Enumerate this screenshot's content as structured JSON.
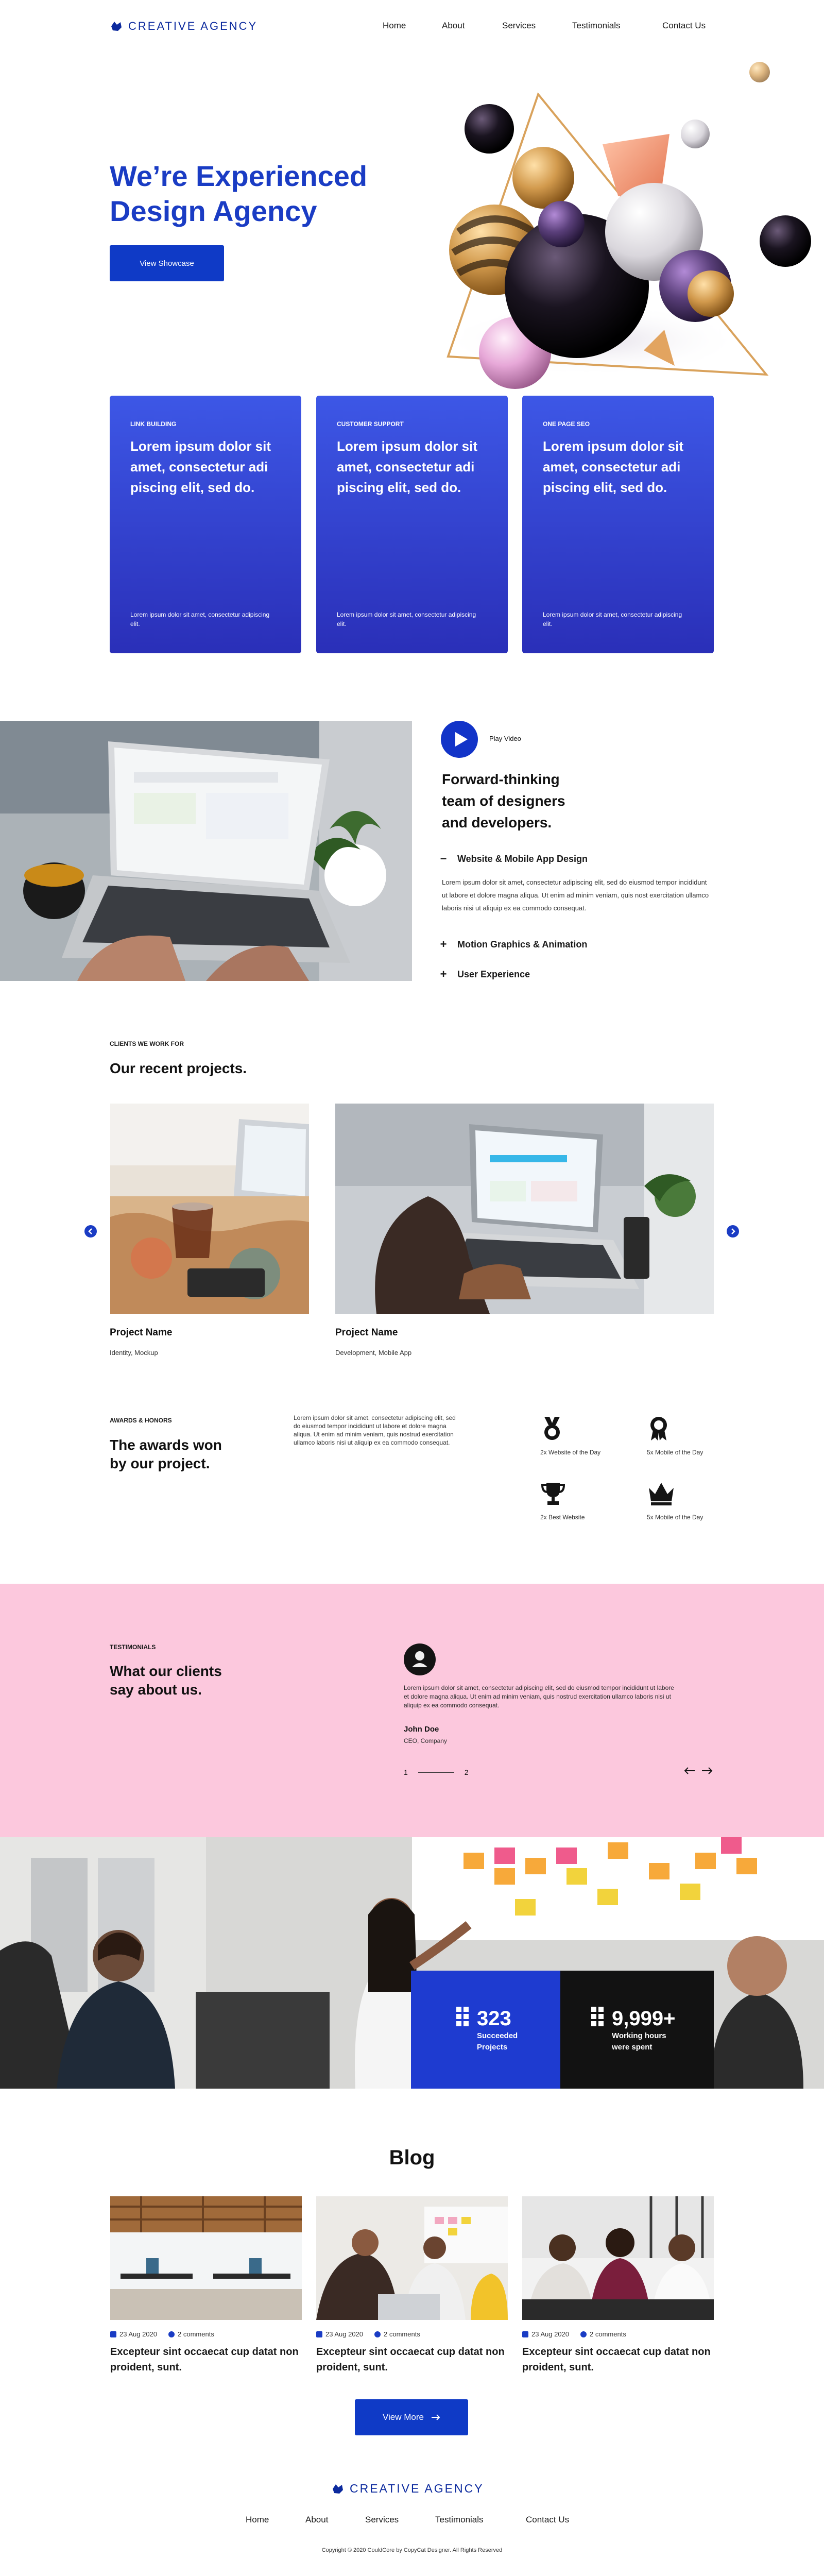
{
  "header": {
    "brand": "CREATIVE AGENCY",
    "nav": [
      "Home",
      "About",
      "Services",
      "Testimonials",
      "Contact Us"
    ]
  },
  "hero": {
    "title_line1": "We’re Experienced",
    "title_line2": "Design Agency",
    "cta": "View Showcase"
  },
  "services": [
    {
      "tag": "LINK BUILDING",
      "title": "Lorem ipsum dolor sit amet, consectetur adi piscing elit, sed do.",
      "text": "Lorem ipsum dolor sit amet, consectetur adipiscing elit."
    },
    {
      "tag": "CUSTOMER SUPPORT",
      "title": "Lorem ipsum dolor sit amet, consectetur adi piscing elit, sed do.",
      "text": "Lorem ipsum dolor sit amet, consectetur adipiscing elit."
    },
    {
      "tag": "ONE PAGE SEO",
      "title": "Lorem ipsum dolor sit amet, consectetur adi piscing elit, sed do.",
      "text": "Lorem ipsum dolor sit amet, consectetur adipiscing elit."
    }
  ],
  "about": {
    "play_label": "Play Video",
    "title_line1": "Forward-thinking",
    "title_line2": "team of designers",
    "title_line3": "and developers.",
    "accordion": [
      {
        "symbol": "−",
        "label": "Website & Mobile App Design",
        "open": true,
        "body": "Lorem ipsum dolor sit amet, consectetur adipiscing elit, sed do eiusmod tempor incididunt ut labore et dolore magna aliqua. Ut enim ad minim veniam, quis nost exercitation ullamco laboris nisi ut aliquip ex ea commodo consequat."
      },
      {
        "symbol": "+",
        "label": "Motion Graphics & Animation",
        "open": false
      },
      {
        "symbol": "+",
        "label": "User Experience",
        "open": false
      }
    ]
  },
  "projects": {
    "tag": "CLIENTS WE WORK FOR",
    "title": "Our recent projects.",
    "items": [
      {
        "name": "Project Name",
        "sub": "Identity, Mockup"
      },
      {
        "name": "Project Name",
        "sub": "Development, Mobile App"
      }
    ]
  },
  "awards": {
    "tag": "AWARDS & HONORS",
    "title_line1": "The awards won",
    "title_line2": "by our project.",
    "text": "Lorem ipsum dolor sit amet, consectetur adipiscing elit, sed do eiusmod tempor incididunt ut labore et dolore magna aliqua. Ut enim ad minim veniam, quis nostrud exercitation ullamco laboris nisi ut aliquip ex ea commodo consequat.",
    "items": [
      {
        "icon": "medal-icon",
        "label": "2x Website of the Day"
      },
      {
        "icon": "ribbon-icon",
        "label": "5x Mobile of the Day"
      },
      {
        "icon": "trophy-icon",
        "label": "2x Best Website"
      },
      {
        "icon": "crown-icon",
        "label": "5x Mobile of the Day"
      }
    ]
  },
  "testimonials": {
    "tag": "TESTIMONIALS",
    "title_line1": "What our clients",
    "title_line2": "say about us.",
    "quote": "Lorem ipsum dolor sit amet, consectetur adipiscing elit, sed do eiusmod tempor incididunt ut labore et dolore magna aliqua. Ut enim ad minim veniam, quis nostrud exercitation ullamco laboris nisi ut aliquip ex ea commodo consequat.",
    "name": "John Doe",
    "role": "CEO, Company",
    "page_current": "1",
    "page_total": "2",
    "bg": "#fcc8dd"
  },
  "stats": [
    {
      "value": "323",
      "label_line1": "Succeeded",
      "label_line2": "Projects"
    },
    {
      "value": "9,999+",
      "label_line1": "Working hours",
      "label_line2": "were spent"
    }
  ],
  "blog": {
    "title": "Blog",
    "posts": [
      {
        "date": "23 Aug 2020",
        "comments": "2 comments",
        "title": "Excepteur sint occaecat cup datat non proident, sunt."
      },
      {
        "date": "23 Aug 2020",
        "comments": "2 comments",
        "title": "Excepteur sint occaecat cup datat non proident, sunt."
      },
      {
        "date": "23 Aug 2020",
        "comments": "2 comments",
        "title": "Excepteur sint occaecat cup datat non proident, sunt."
      }
    ],
    "more": "View More"
  },
  "footer": {
    "brand": "CREATIVE AGENCY",
    "nav": [
      "Home",
      "About",
      "Services",
      "Testimonials",
      "Contact Us"
    ],
    "copyright": "Copyright © 2020 CouldCore by CopyCat Designer. All Rights Reserved"
  },
  "colors": {
    "accent": "#1a3cc4",
    "dark": "#121212",
    "pink": "#fcc8dd"
  }
}
